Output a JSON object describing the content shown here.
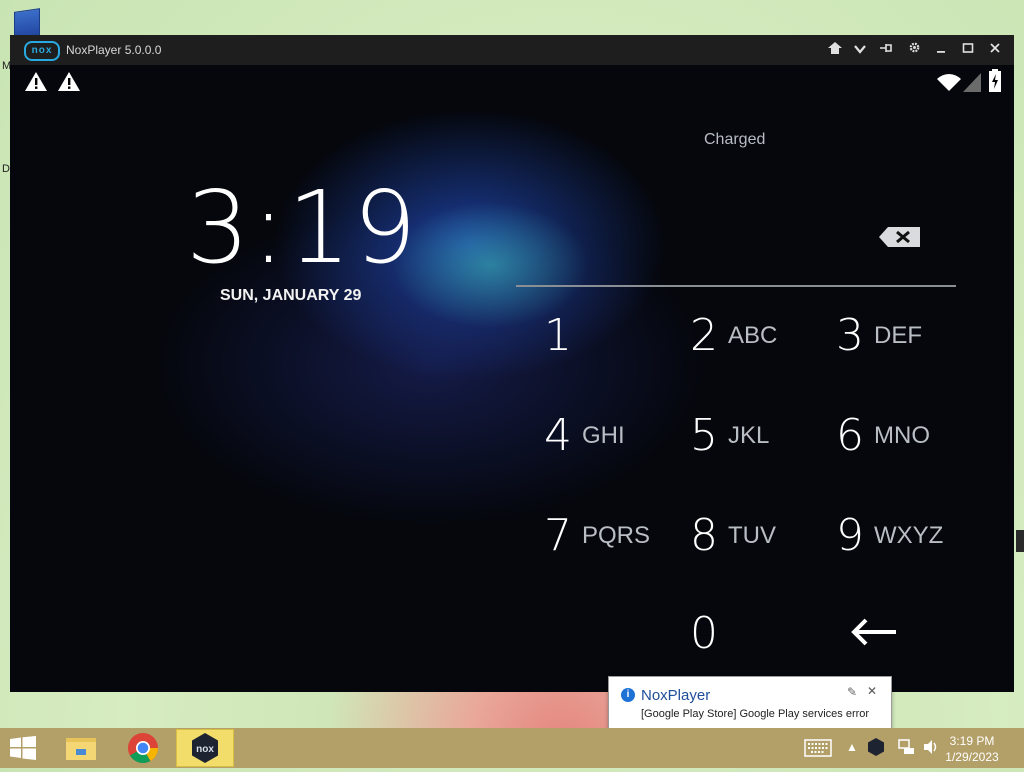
{
  "window": {
    "title": "NoxPlayer 5.0.0.0",
    "logo_text": "nox",
    "controls": [
      "home-icon",
      "chevron-down-icon",
      "pin-icon",
      "gear-icon",
      "minimize-icon",
      "maximize-icon",
      "close-icon"
    ]
  },
  "lockscreen": {
    "battery_status": "Charged",
    "time": "3:19",
    "date": "SUN, JANUARY 29",
    "keypad": [
      {
        "num": "1",
        "letters": ""
      },
      {
        "num": "2",
        "letters": "ABC"
      },
      {
        "num": "3",
        "letters": "DEF"
      },
      {
        "num": "4",
        "letters": "GHI"
      },
      {
        "num": "5",
        "letters": "JKL"
      },
      {
        "num": "6",
        "letters": "MNO"
      },
      {
        "num": "7",
        "letters": "PQRS"
      },
      {
        "num": "8",
        "letters": "TUV"
      },
      {
        "num": "9",
        "letters": "WXYZ"
      },
      {
        "num": "0",
        "letters": ""
      }
    ]
  },
  "notification": {
    "title": "NoxPlayer",
    "message": "[Google Play Store] Google Play services error"
  },
  "taskbar": {
    "clock_time": "3:19 PM",
    "clock_date": "1/29/2023",
    "nox_tray_text": "nox"
  },
  "colors": {
    "nox_blue": "#29a9e1",
    "taskbar": "#b39f68",
    "active_app": "#f3dd6a"
  }
}
